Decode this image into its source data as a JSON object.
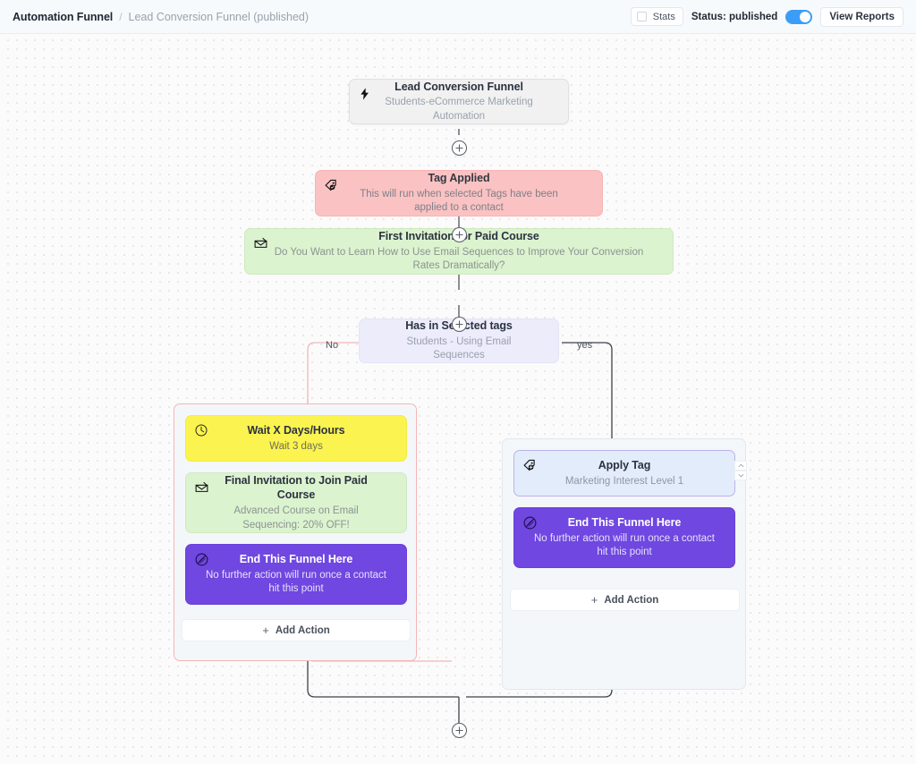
{
  "header": {
    "breadcrumb_root": "Automation Funnel",
    "breadcrumb_separator": "/",
    "breadcrumb_leaf": "Lead Conversion Funnel (published)",
    "stats_label": "Stats",
    "status_label": "Status: published",
    "toggle_on": true,
    "view_reports_label": "View Reports",
    "accent_color": "#3b9df8"
  },
  "flow": {
    "trigger": {
      "icon": "lightning-bolt-icon",
      "title": "Lead Conversion Funnel",
      "subtitle": "Students-eCommerce Marketing Automation",
      "color": "#f1f1f1"
    },
    "tag_applied": {
      "icon": "tag-check-icon",
      "title": "Tag Applied",
      "subtitle": "This will run when selected Tags have been applied to a contact",
      "color": "#fbc2c3"
    },
    "first_invitation": {
      "icon": "email-icon",
      "title": "First Invitation for Paid Course",
      "subtitle": "Do You Want to Learn How to Use Email Sequences to Improve Your Conversion Rates Dramatically?",
      "color": "#dcf3cf"
    },
    "condition": {
      "title": "Has in Selected tags",
      "subtitle": "Students - Using Email Sequences",
      "color": "#ececfb",
      "branch_no_label": "No",
      "branch_yes_label": "yes"
    },
    "left_branch": {
      "wait": {
        "icon": "clock-icon",
        "title": "Wait X Days/Hours",
        "subtitle": "Wait 3 days",
        "color": "#fbf350"
      },
      "final_invitation": {
        "icon": "email-icon",
        "title": "Final Invitation to Join Paid Course",
        "subtitle": "Advanced Course on Email Sequencing: 20% OFF!",
        "color": "#dcf3cf"
      },
      "end_funnel": {
        "icon": "ban-icon",
        "title": "End This Funnel Here",
        "subtitle": "No further action will run once a contact hit this point",
        "color": "#7047e0"
      },
      "add_action_label": "Add Action",
      "add_action_plus": "+"
    },
    "right_branch": {
      "apply_tag": {
        "icon": "tag-plus-icon",
        "title": "Apply Tag",
        "subtitle": "Marketing Interest Level 1",
        "color": "#e3ecfb"
      },
      "end_funnel": {
        "icon": "ban-icon",
        "title": "End This Funnel Here",
        "subtitle": "No further action will run once a contact hit this point",
        "color": "#7047e0"
      },
      "add_action_label": "Add Action",
      "add_action_plus": "+"
    }
  }
}
